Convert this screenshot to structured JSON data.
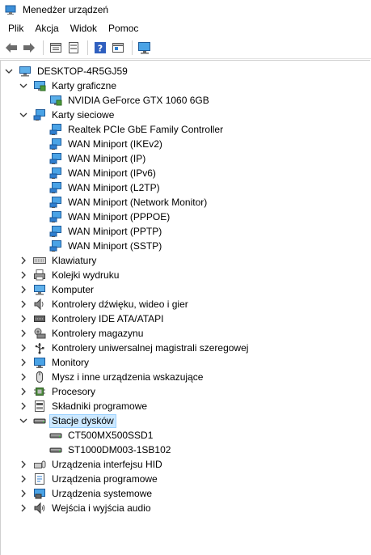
{
  "window": {
    "title": "Menedżer urządzeń"
  },
  "menu": {
    "file": "Plik",
    "action": "Akcja",
    "view": "Widok",
    "help": "Pomoc"
  },
  "toolbar": {
    "buttons": [
      "back-icon",
      "forward-icon",
      "properties-icon",
      "show-hidden-icon",
      "help-icon",
      "view-icon",
      "monitor-scan-icon"
    ]
  },
  "tree": {
    "root": "DESKTOP-4R5GJ59",
    "categories": [
      {
        "label": "Karty graficzne",
        "expanded": true,
        "icon": "display-adapter-icon",
        "children": [
          "NVIDIA GeForce GTX 1060 6GB"
        ]
      },
      {
        "label": "Karty sieciowe",
        "expanded": true,
        "icon": "network-adapter-icon",
        "children": [
          "Realtek PCIe GbE Family Controller",
          "WAN Miniport (IKEv2)",
          "WAN Miniport (IP)",
          "WAN Miniport (IPv6)",
          "WAN Miniport (L2TP)",
          "WAN Miniport (Network Monitor)",
          "WAN Miniport (PPPOE)",
          "WAN Miniport (PPTP)",
          "WAN Miniport (SSTP)"
        ]
      },
      {
        "label": "Klawiatury",
        "expanded": false,
        "icon": "keyboard-icon"
      },
      {
        "label": "Kolejki wydruku",
        "expanded": false,
        "icon": "printer-icon"
      },
      {
        "label": "Komputer",
        "expanded": false,
        "icon": "computer-icon"
      },
      {
        "label": "Kontrolery dźwięku, wideo i gier",
        "expanded": false,
        "icon": "speaker-icon"
      },
      {
        "label": "Kontrolery IDE ATA/ATAPI",
        "expanded": false,
        "icon": "ide-controller-icon"
      },
      {
        "label": "Kontrolery magazynu",
        "expanded": false,
        "icon": "storage-controller-icon"
      },
      {
        "label": "Kontrolery uniwersalnej magistrali szeregowej",
        "expanded": false,
        "icon": "usb-icon"
      },
      {
        "label": "Monitory",
        "expanded": false,
        "icon": "monitor-icon"
      },
      {
        "label": "Mysz i inne urządzenia wskazujące",
        "expanded": false,
        "icon": "mouse-icon"
      },
      {
        "label": "Procesory",
        "expanded": false,
        "icon": "processor-icon"
      },
      {
        "label": "Składniki programowe",
        "expanded": false,
        "icon": "software-component-icon"
      },
      {
        "label": "Stacje dysków",
        "expanded": true,
        "selected": true,
        "icon": "disk-drive-icon",
        "children": [
          "CT500MX500SSD1",
          "ST1000DM003-1SB102"
        ]
      },
      {
        "label": "Urządzenia interfejsu HID",
        "expanded": false,
        "icon": "hid-icon"
      },
      {
        "label": "Urządzenia programowe",
        "expanded": false,
        "icon": "software-device-icon"
      },
      {
        "label": "Urządzenia systemowe",
        "expanded": false,
        "icon": "system-device-icon"
      },
      {
        "label": "Wejścia i wyjścia audio",
        "expanded": false,
        "icon": "audio-io-icon"
      }
    ]
  },
  "colors": {
    "selection_bg": "#cce8ff",
    "selection_border": "#99d1ff",
    "adapter_blue": "#1e90ff"
  }
}
